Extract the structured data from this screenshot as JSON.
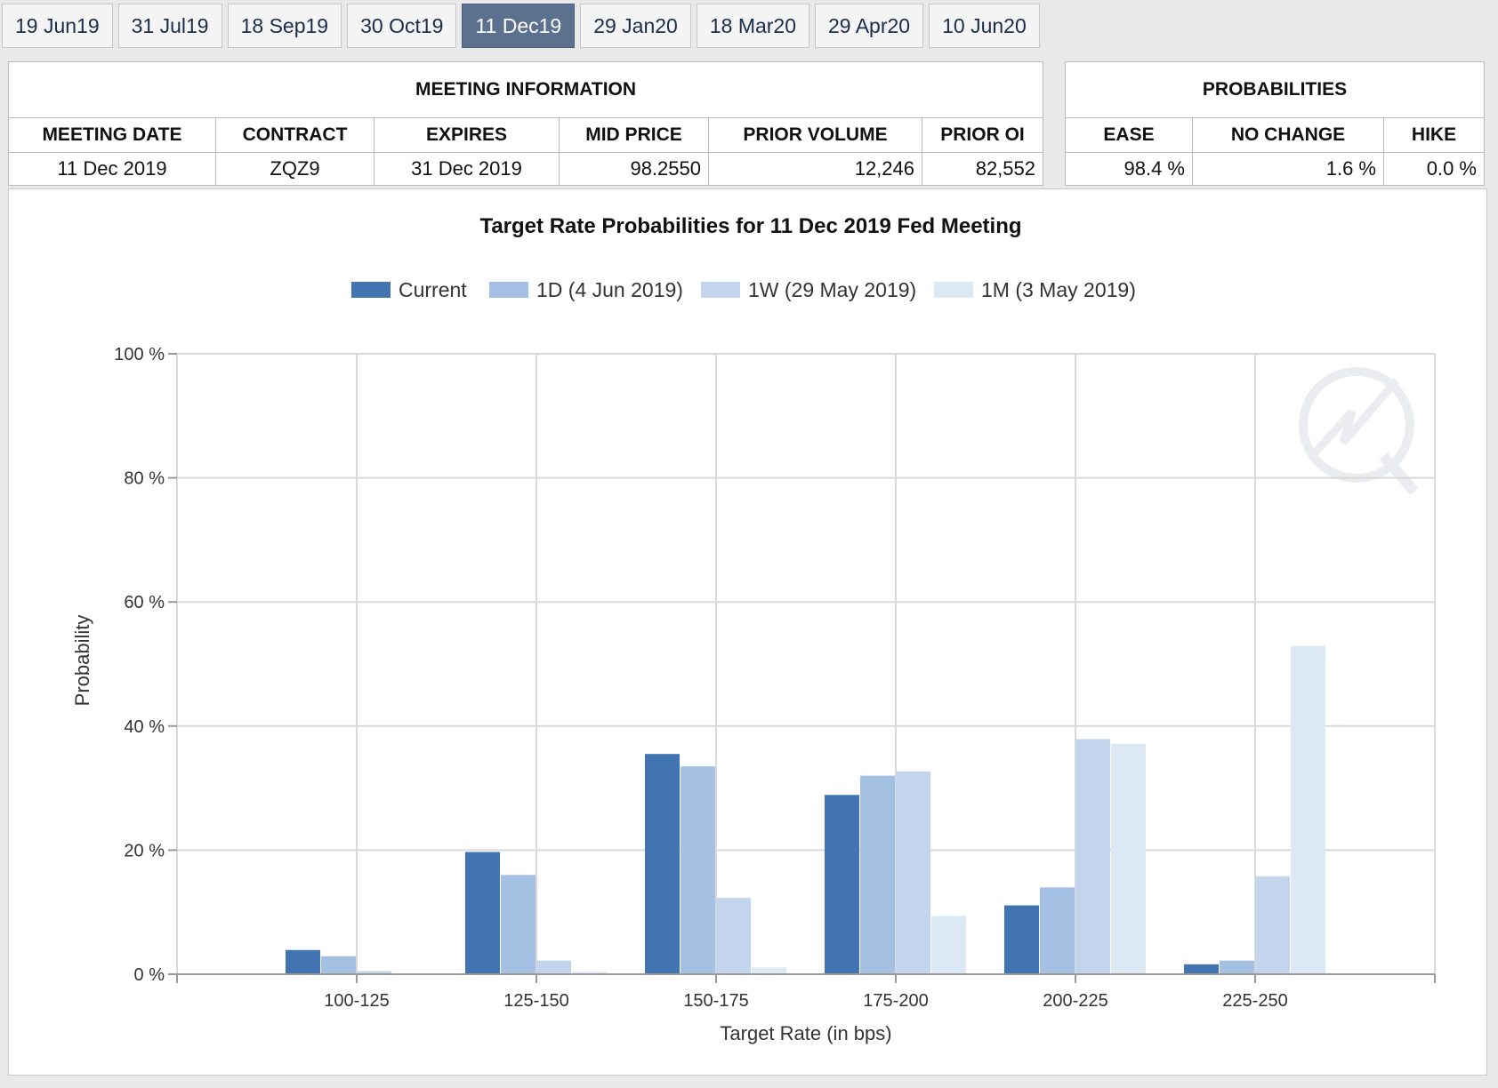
{
  "tabs": [
    {
      "label": "19 Jun19"
    },
    {
      "label": "31 Jul19"
    },
    {
      "label": "18 Sep19"
    },
    {
      "label": "30 Oct19"
    },
    {
      "label": "11 Dec19",
      "active": true
    },
    {
      "label": "29 Jan20"
    },
    {
      "label": "18 Mar20"
    },
    {
      "label": "29 Apr20"
    },
    {
      "label": "10 Jun20"
    }
  ],
  "meeting_info": {
    "heading": "MEETING INFORMATION",
    "columns": [
      "MEETING DATE",
      "CONTRACT",
      "EXPIRES",
      "MID PRICE",
      "PRIOR VOLUME",
      "PRIOR OI"
    ],
    "row": [
      "11 Dec 2019",
      "ZQZ9",
      "31 Dec 2019",
      "98.2550",
      "12,246",
      "82,552"
    ]
  },
  "probabilities": {
    "heading": "PROBABILITIES",
    "columns": [
      "EASE",
      "NO CHANGE",
      "HIKE"
    ],
    "row": [
      "98.4 %",
      "1.6 %",
      "0.0 %"
    ]
  },
  "colors": {
    "current": "#4174b0",
    "d1": "#a4c0e3",
    "w1": "#c2d5ec",
    "m1": "#dde8f5",
    "grid": "#d9d9d9"
  },
  "chart_data": {
    "type": "bar",
    "title": "Target Rate Probabilities for 11 Dec 2019 Fed Meeting",
    "xlabel": "Target Rate (in bps)",
    "ylabel": "Probability",
    "ylim": [
      0,
      100
    ],
    "yticks": [
      0,
      20,
      40,
      60,
      80,
      100
    ],
    "ytick_labels": [
      "0 %",
      "20 %",
      "40 %",
      "60 %",
      "80 %",
      "100 %"
    ],
    "categories": [
      "100-125",
      "125-150",
      "150-175",
      "175-200",
      "200-225",
      "225-250"
    ],
    "legend_position": "top-center",
    "grid": true,
    "series": [
      {
        "name": "Current",
        "color_key": "current",
        "values": [
          3.9,
          19.7,
          35.5,
          28.9,
          11.1,
          1.6
        ]
      },
      {
        "name": "1D (4 Jun 2019)",
        "color_key": "d1",
        "values": [
          2.9,
          16.0,
          33.5,
          32.0,
          14.0,
          2.2
        ]
      },
      {
        "name": "1W (29 May 2019)",
        "color_key": "w1",
        "values": [
          0.5,
          2.2,
          12.3,
          32.7,
          37.9,
          15.8
        ]
      },
      {
        "name": "1M (3 May 2019)",
        "color_key": "m1",
        "values": [
          0.0,
          0.4,
          1.1,
          9.4,
          37.1,
          52.9
        ]
      }
    ]
  }
}
